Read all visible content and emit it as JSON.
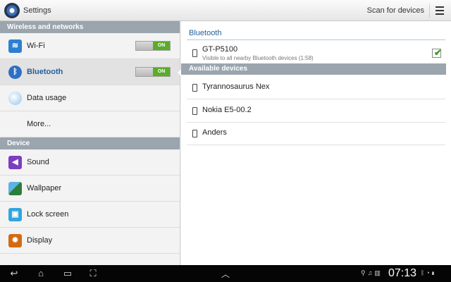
{
  "app": {
    "title": "Settings"
  },
  "actionbar": {
    "scan_label": "Scan for devices"
  },
  "sections": {
    "wireless": "Wireless and networks",
    "device": "Device"
  },
  "settings": {
    "wifi": {
      "label": "Wi-Fi",
      "toggle": "ON",
      "icon": "wifi-icon"
    },
    "bluetooth": {
      "label": "Bluetooth",
      "toggle": "ON",
      "icon": "bluetooth-icon"
    },
    "data_usage": {
      "label": "Data usage",
      "icon": "data-usage-icon"
    },
    "more": {
      "label": "More..."
    },
    "sound": {
      "label": "Sound",
      "icon": "sound-icon"
    },
    "wallpaper": {
      "label": "Wallpaper",
      "icon": "wallpaper-icon"
    },
    "lock_screen": {
      "label": "Lock screen",
      "icon": "lock-icon"
    },
    "display": {
      "label": "Display",
      "icon": "display-icon"
    }
  },
  "bluetooth_panel": {
    "title": "Bluetooth",
    "own_device": {
      "name": "GT-P5100",
      "status": "Visible to all nearby Bluetooth devices (1:58)",
      "checked": true
    },
    "available_header": "Available devices",
    "devices": [
      {
        "name": "Tyrannosaurus Nex"
      },
      {
        "name": "Nokia E5-00.2"
      },
      {
        "name": "Anders"
      }
    ]
  },
  "statusbar": {
    "time": "07:13"
  },
  "colors": {
    "accent": "#1f5f9c",
    "toggle_on": "#5cab2a",
    "section_header": "#9aa5ae"
  }
}
